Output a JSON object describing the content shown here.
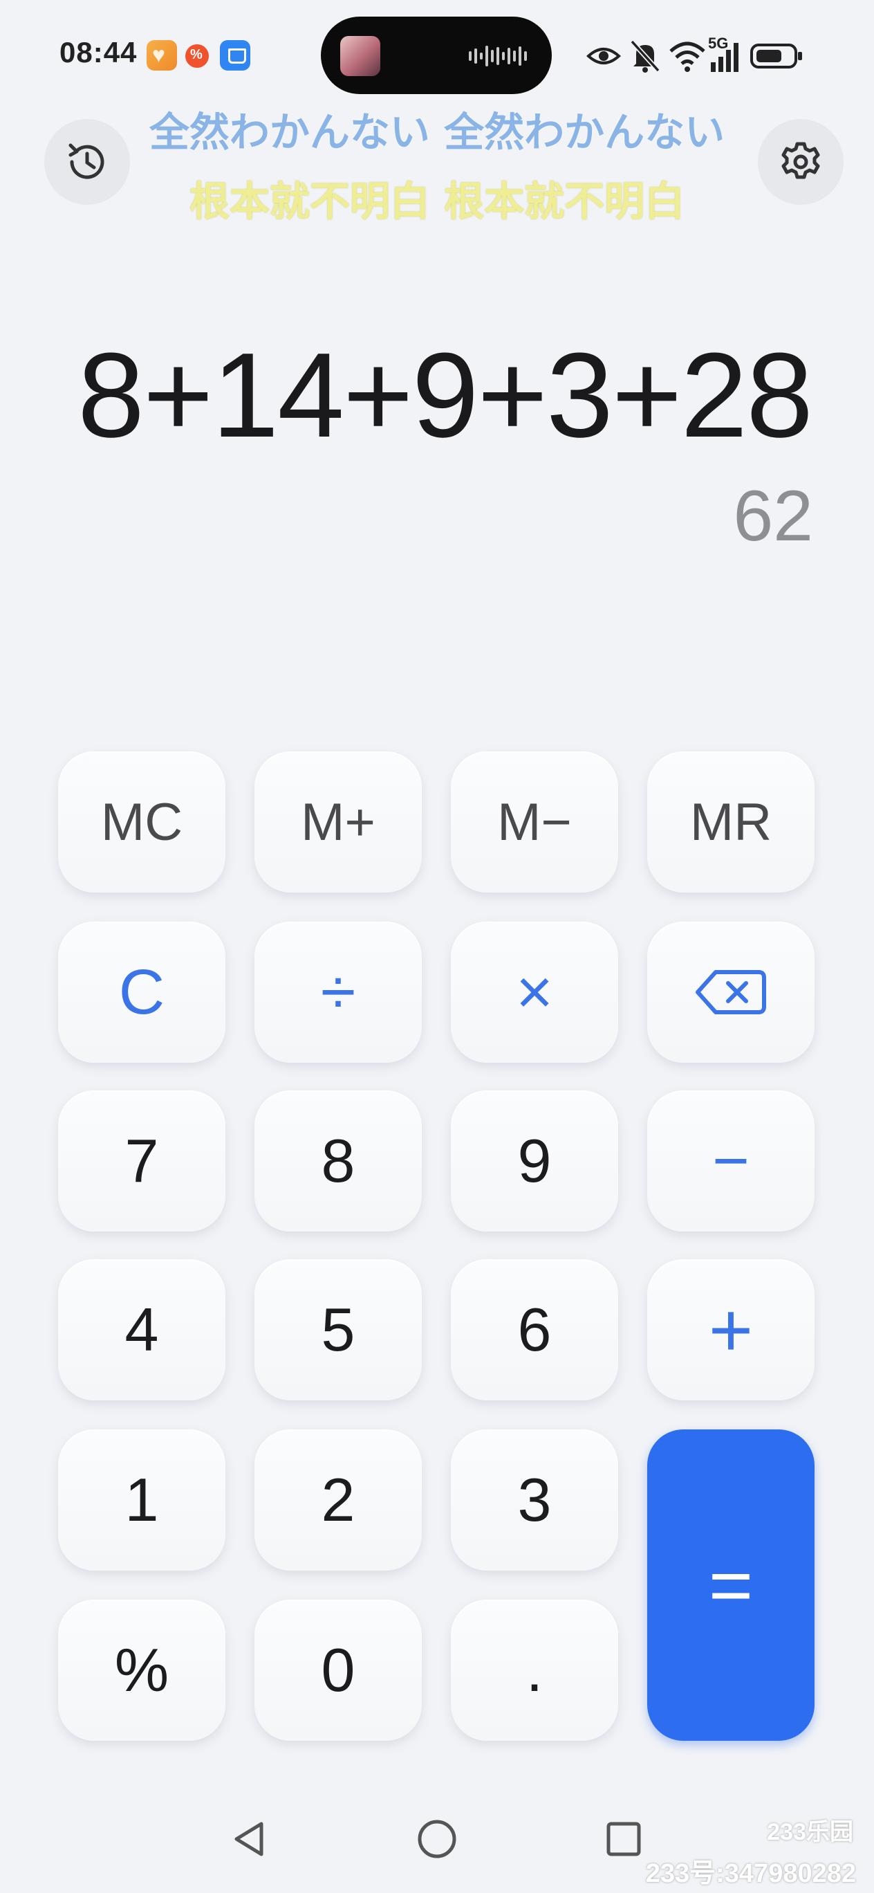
{
  "status_bar": {
    "time": "08:44",
    "network": "5G",
    "notification_icons": [
      "heart-app-icon",
      "coupon-app-icon",
      "app-store-icon"
    ],
    "system_icons": [
      "eye-icon",
      "mute-bell-icon",
      "wifi-icon",
      "signal-icon",
      "battery-icon"
    ]
  },
  "lyrics": {
    "line_1": "全然わかんない 全然わかんない",
    "line_2": "根本就不明白 根本就不明白"
  },
  "display": {
    "expression": "8+14+9+3+28",
    "result": "62"
  },
  "keypad": {
    "mc": "MC",
    "m_plus": "M+",
    "m_minus": "M−",
    "mr": "MR",
    "clear": "C",
    "divide": "÷",
    "multiply": "×",
    "seven": "7",
    "eight": "8",
    "nine": "9",
    "minus": "−",
    "four": "4",
    "five": "5",
    "six": "6",
    "plus": "+",
    "one": "1",
    "two": "2",
    "three": "3",
    "equals": "=",
    "percent": "%",
    "zero": "0",
    "dot": "."
  },
  "watermark": {
    "logo": "233乐园",
    "id_text": "233号:347980282"
  },
  "colors": {
    "accent": "#2d6ef0",
    "operator": "#3b74e6",
    "background": "#f1f3f6",
    "result_text": "#8c8f94"
  }
}
